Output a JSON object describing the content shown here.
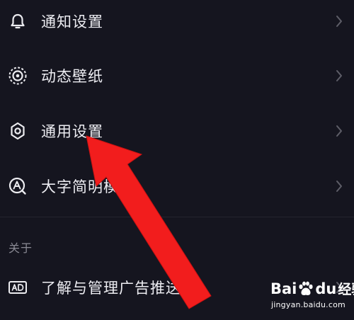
{
  "settings": {
    "items": [
      {
        "label": "通知设置",
        "icon": "bell-icon"
      },
      {
        "label": "动态壁纸",
        "icon": "live-wallpaper-icon"
      },
      {
        "label": "通用设置",
        "icon": "gear-icon"
      },
      {
        "label": "大字简明模",
        "icon": "large-font-icon"
      }
    ]
  },
  "about": {
    "section_title": "关于",
    "items": [
      {
        "label": "了解与管理广告推送",
        "icon": "ad-icon"
      }
    ]
  },
  "annotation": {
    "arrow_color": "#f21d1d"
  },
  "watermark": {
    "logo_text_1": "Bai",
    "logo_text_2": "du",
    "logo_text_3": "经验",
    "url": "jingyan.baidu.com"
  },
  "colors": {
    "background": "#15151f",
    "text": "#ededf2",
    "secondary_text": "#8a8a94",
    "chevron": "#5e5e68"
  }
}
